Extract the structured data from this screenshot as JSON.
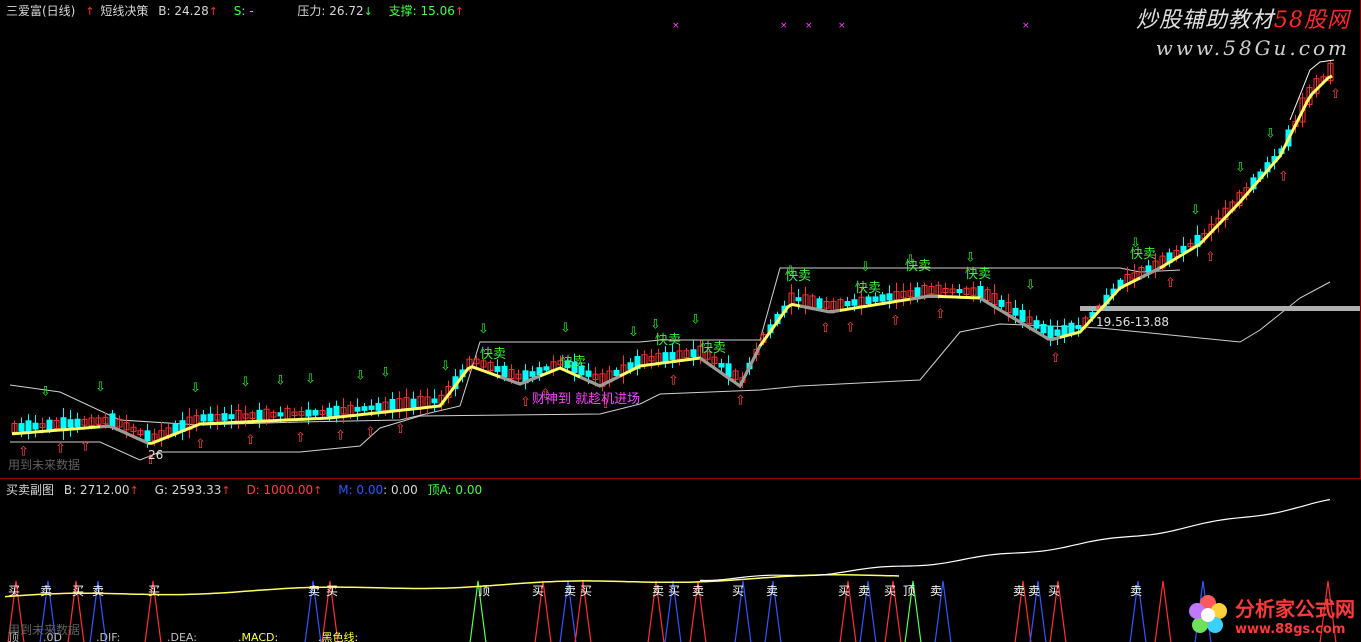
{
  "main": {
    "title": "三爱富(日线)",
    "indicator": "短线决策",
    "b_label": "B: 24.28",
    "s_label": "S: -",
    "pressure_label": "压力: 26.72",
    "support_label": "支撑: 15.06",
    "watermark_l1_a": "炒股辅助教材",
    "watermark_l1_b": "58股网",
    "watermark_l2": "www.58Gu.com",
    "range_label": "19.56-13.88",
    "low_label": "26",
    "future_note": "用到未来数据",
    "buy_text": "快卖",
    "pink_text": "财神到 就趁机进场"
  },
  "sub": {
    "title": "买卖副图",
    "b_label": "B: 2712.00",
    "g_label": "G: 2593.33",
    "d_label": "D: 1000.00",
    "m_label": "M: 0.00",
    "m_value": ": 0.00",
    "ding_label": "顶A: 0.00",
    "future_note": "用到未来数据",
    "bottom_labels": [
      "顶",
      ".0D",
      ".DIF:",
      ".DEA:",
      ".MACD:",
      ".黑色线:"
    ],
    "buy": "买",
    "sell": "卖",
    "top_label": "顶"
  },
  "logo": {
    "name": "分析家公式网",
    "url": "www.88gs.com"
  },
  "colors": {
    "up": "#ff3030",
    "down": "#00ffff",
    "ma": "#ffff66",
    "line": "#ffffff"
  },
  "chart_data": {
    "type": "candlestick",
    "title": "三爱富(日线)",
    "pressure": 26.72,
    "support": 15.06,
    "b_value": 24.28,
    "range_band": [
      13.88,
      19.56
    ]
  }
}
